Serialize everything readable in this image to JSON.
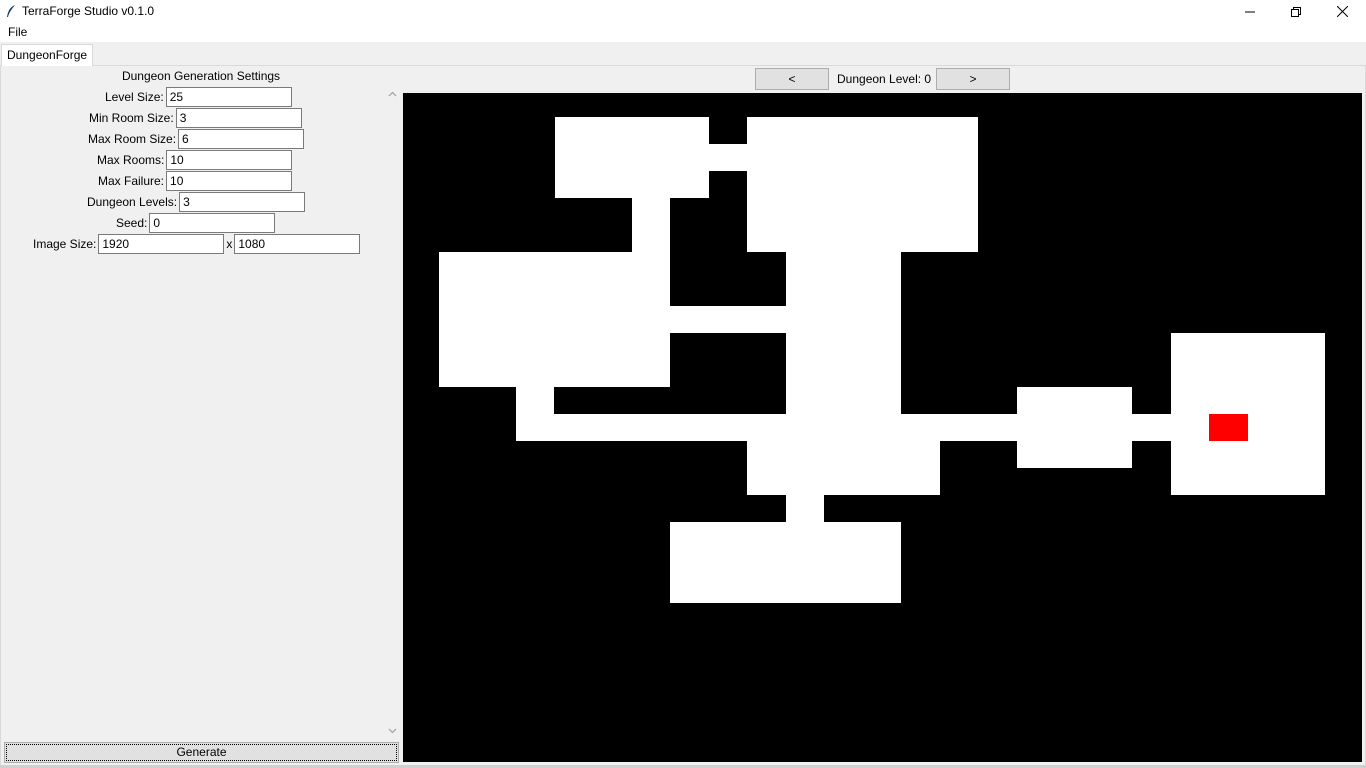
{
  "window": {
    "title": "TerraForge Studio v0.1.0",
    "icon": "feather-icon",
    "controls": [
      "minimize-icon",
      "restore-icon",
      "close-icon"
    ]
  },
  "menu": {
    "file": "File"
  },
  "tabs": [
    {
      "label": "DungeonForge"
    }
  ],
  "settings": {
    "title": "Dungeon Generation Settings",
    "level_size": {
      "label": "Level Size:",
      "value": "25"
    },
    "min_room_size": {
      "label": "Min Room Size:",
      "value": "3"
    },
    "max_room_size": {
      "label": "Max Room Size:",
      "value": "6"
    },
    "max_rooms": {
      "label": "Max Rooms:",
      "value": "10"
    },
    "max_failure": {
      "label": "Max Failure:",
      "value": "10"
    },
    "dungeon_levels": {
      "label": "Dungeon Levels:",
      "value": "3"
    },
    "seed": {
      "label": "Seed:",
      "value": "0"
    },
    "image_size": {
      "label": "Image Size:",
      "width": "1920",
      "separator": "x",
      "height": "1080"
    }
  },
  "generate_label": "Generate",
  "level_nav": {
    "prev_label": "<",
    "next_label": ">",
    "level_text": "Dungeon Level: 0"
  },
  "colors": {
    "floor": "#ffffff",
    "wall": "#000000",
    "marker": "#ff0000"
  }
}
